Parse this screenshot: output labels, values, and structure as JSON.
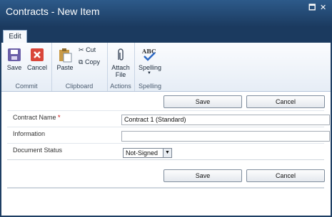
{
  "window": {
    "title": "Contracts - New Item"
  },
  "tabs": [
    {
      "label": "Edit"
    }
  ],
  "ribbon": {
    "commit": {
      "label": "Commit",
      "save": "Save",
      "cancel": "Cancel"
    },
    "clipboard": {
      "label": "Clipboard",
      "paste": "Paste",
      "cut": "Cut",
      "copy": "Copy"
    },
    "actions": {
      "label": "Actions",
      "attach_file": "Attach File"
    },
    "spelling": {
      "label": "Spelling",
      "spelling": "Spelling"
    }
  },
  "form": {
    "top_buttons": {
      "save": "Save",
      "cancel": "Cancel"
    },
    "bottom_buttons": {
      "save": "Save",
      "cancel": "Cancel"
    },
    "fields": [
      {
        "label": "Contract Name",
        "required_marker": "*",
        "value": "Contract 1 (Standard)"
      },
      {
        "label": "Information",
        "value": ""
      },
      {
        "label": "Document Status",
        "value": "Not-Signed"
      }
    ]
  }
}
